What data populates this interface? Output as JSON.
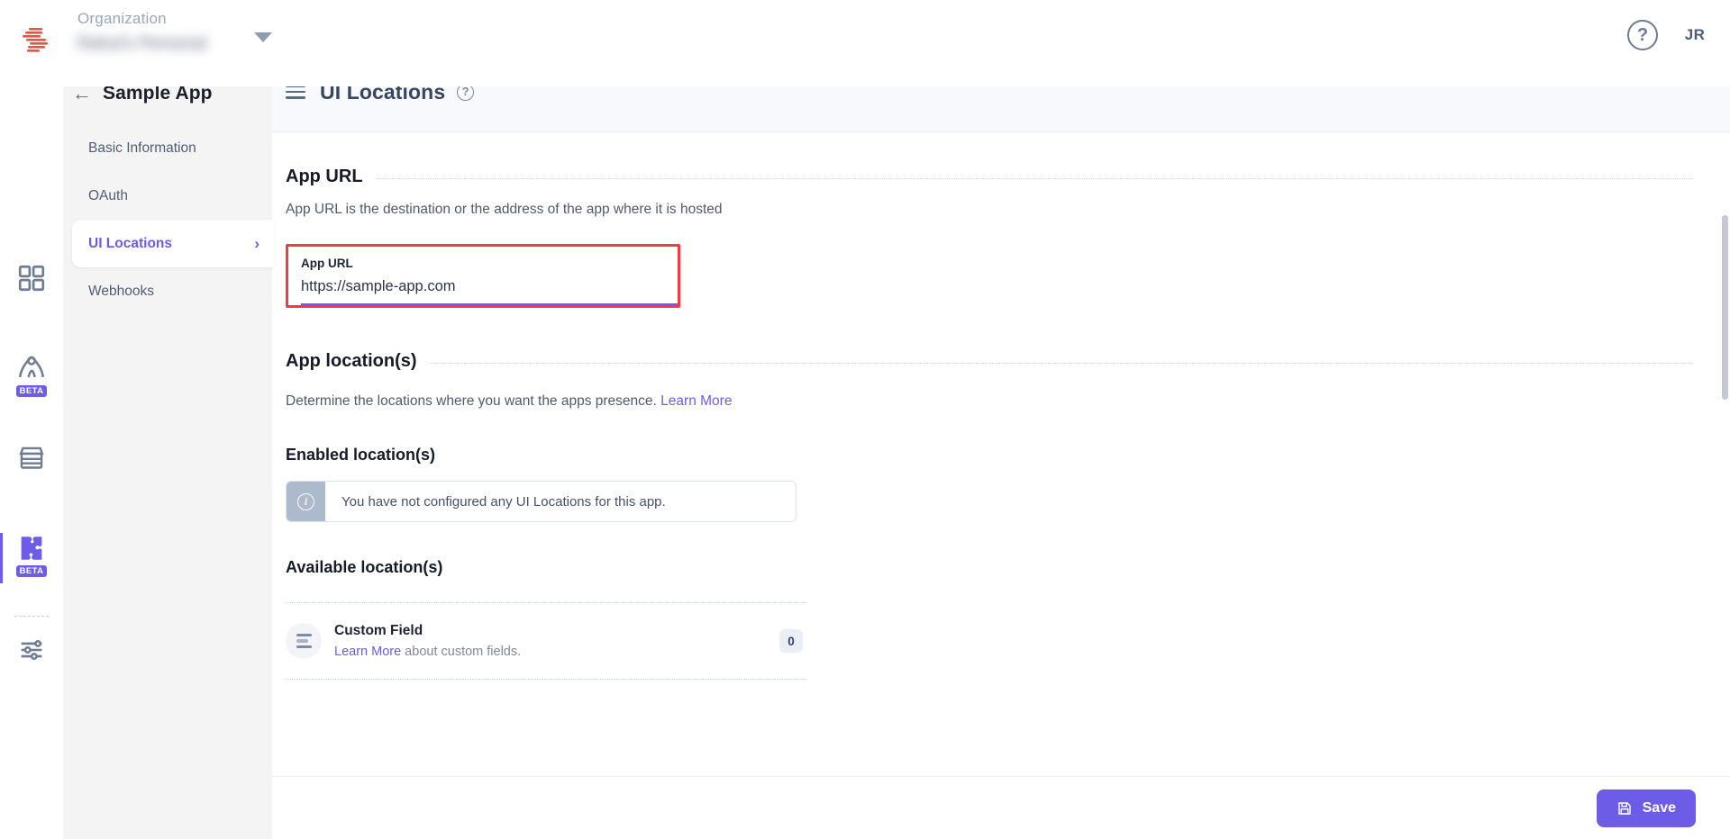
{
  "topbar": {
    "org_label": "Organization",
    "org_value": "Rahul's Personal",
    "help_icon": "question-mark-icon",
    "avatar_initials": "JR",
    "logo_icon": "freshworks-logo-icon",
    "caret_icon": "chevron-down-icon"
  },
  "rail": {
    "items": [
      {
        "name": "dashboard-grid",
        "icon": "grid-icon",
        "badge": "",
        "active": false
      },
      {
        "name": "analytics",
        "icon": "compass-icon",
        "badge": "BETA",
        "active": false
      },
      {
        "name": "marketplace",
        "icon": "store-icon",
        "badge": "",
        "active": false
      },
      {
        "name": "apps",
        "icon": "puzzle-icon",
        "badge": "BETA",
        "active": true
      },
      {
        "name": "settings",
        "icon": "sliders-icon",
        "badge": "",
        "active": false
      }
    ]
  },
  "leftpanel": {
    "back_icon": "arrow-left-icon",
    "title": "Sample App",
    "nav": [
      {
        "label": "Basic Information",
        "active": false
      },
      {
        "label": "OAuth",
        "active": false
      },
      {
        "label": "UI Locations",
        "active": true
      },
      {
        "label": "Webhooks",
        "active": false
      }
    ]
  },
  "main": {
    "menu_icon": "hamburger-icon",
    "title": "UI Locations",
    "title_help_icon": "help-circle-icon",
    "app_url": {
      "heading": "App URL",
      "description": "App URL is the destination or the address of the app where it is hosted",
      "field_label": "App URL",
      "field_value": "https://sample-app.com",
      "field_placeholder": "https://"
    },
    "app_locations": {
      "heading": "App location(s)",
      "description": "Determine the locations where you want the apps presence.",
      "learn_more": "Learn More",
      "enabled_heading": "Enabled location(s)",
      "empty_icon": "info-icon",
      "empty_message": "You have not configured any UI Locations for this app.",
      "available_heading": "Available location(s)",
      "rows": [
        {
          "icon": "custom-field-lines-icon",
          "title": "Custom Field",
          "link": "Learn More",
          "sub_suffix": " about custom fields.",
          "count": "0"
        }
      ]
    }
  },
  "footer": {
    "save_label": "Save",
    "save_icon": "floppy-disk-icon"
  },
  "colors": {
    "accent": "#6c5ce7",
    "highlight": "#f03c3c",
    "panel_bg": "#f4f4f5",
    "header_bg": "#f8f9fc",
    "logo_red": "#e8523f"
  }
}
